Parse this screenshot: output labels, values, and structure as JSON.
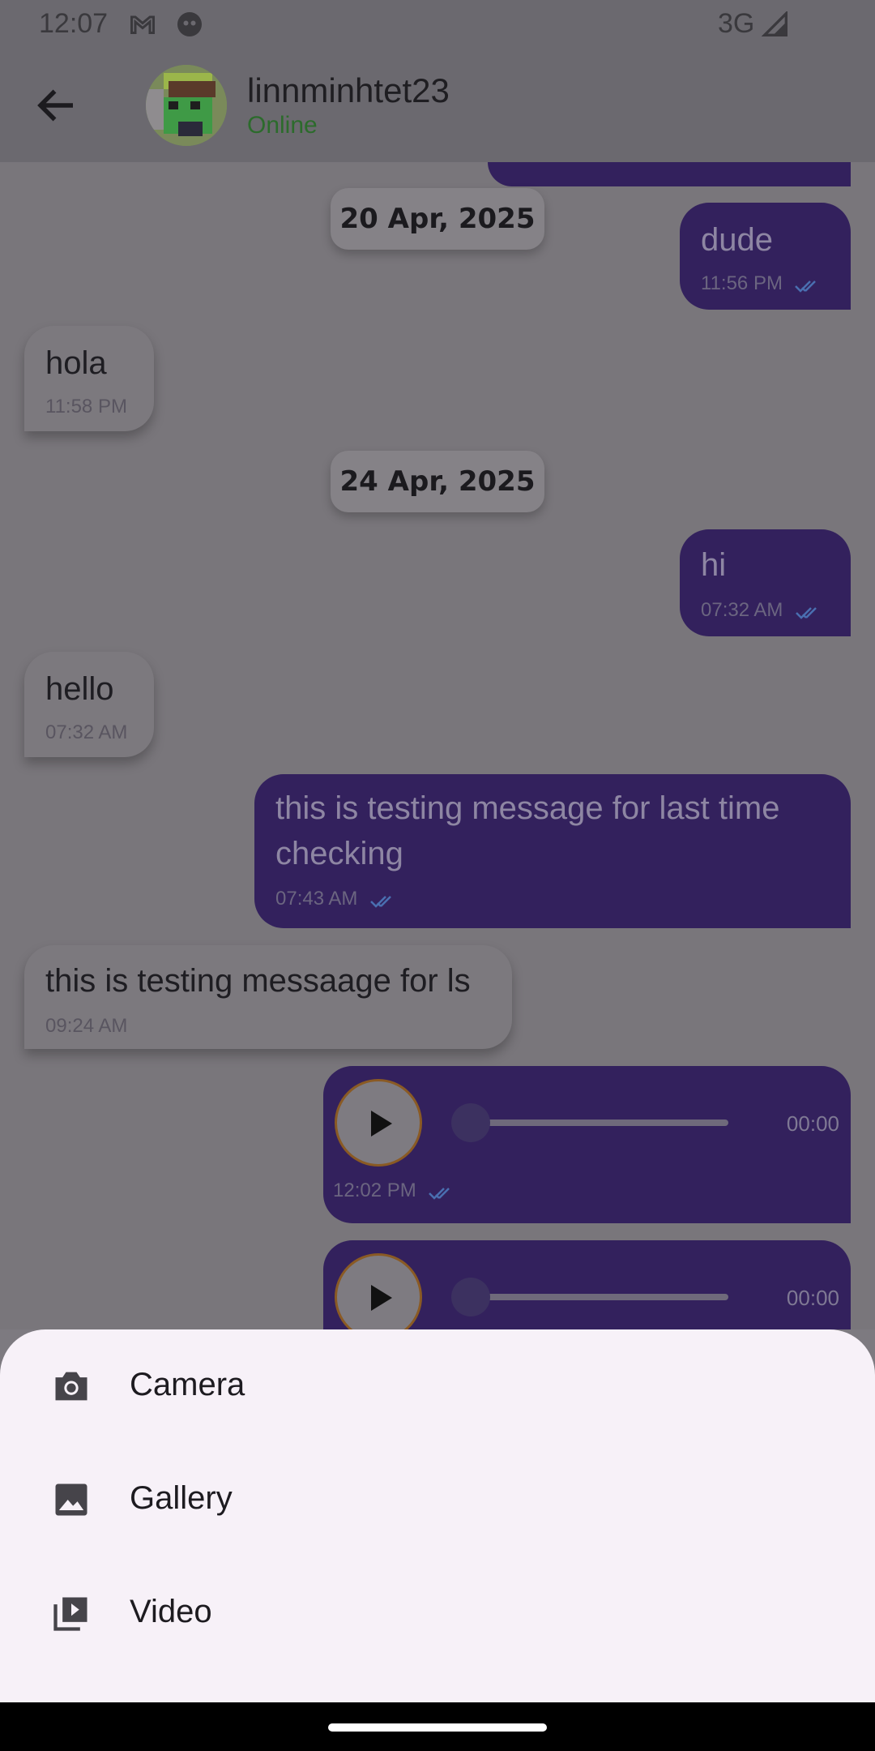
{
  "status_bar": {
    "time": "12:07",
    "network": "3G"
  },
  "header": {
    "username": "linnminhtet23",
    "status": "Online"
  },
  "messages": {
    "date1": "20 Apr, 2025",
    "date2": "24 Apr, 2025",
    "m1": {
      "text": "dude",
      "time": "11:56 PM"
    },
    "m2": {
      "text": "hola",
      "time": "11:58 PM"
    },
    "m3": {
      "text": "hi",
      "time": "07:32 AM"
    },
    "m4": {
      "text": "hello",
      "time": "07:32 AM"
    },
    "m5": {
      "text": "this is testing message for last time checking",
      "time": "07:43 AM"
    },
    "m6": {
      "text": "this is testing messaage for ls",
      "time": "09:24 AM"
    },
    "voice1": {
      "duration": "00:00",
      "time": "12:02 PM",
      "progress": 0
    },
    "voice2": {
      "duration": "00:00",
      "progress": 0
    }
  },
  "sheet": {
    "items": [
      {
        "label": "Camera",
        "icon": "camera-icon"
      },
      {
        "label": "Gallery",
        "icon": "image-icon"
      },
      {
        "label": "Video",
        "icon": "video-library-icon"
      }
    ]
  },
  "colors": {
    "outgoing_bubble": "#33215d",
    "online": "#2c6b2c",
    "sheet_bg": "#f7f1f8"
  }
}
